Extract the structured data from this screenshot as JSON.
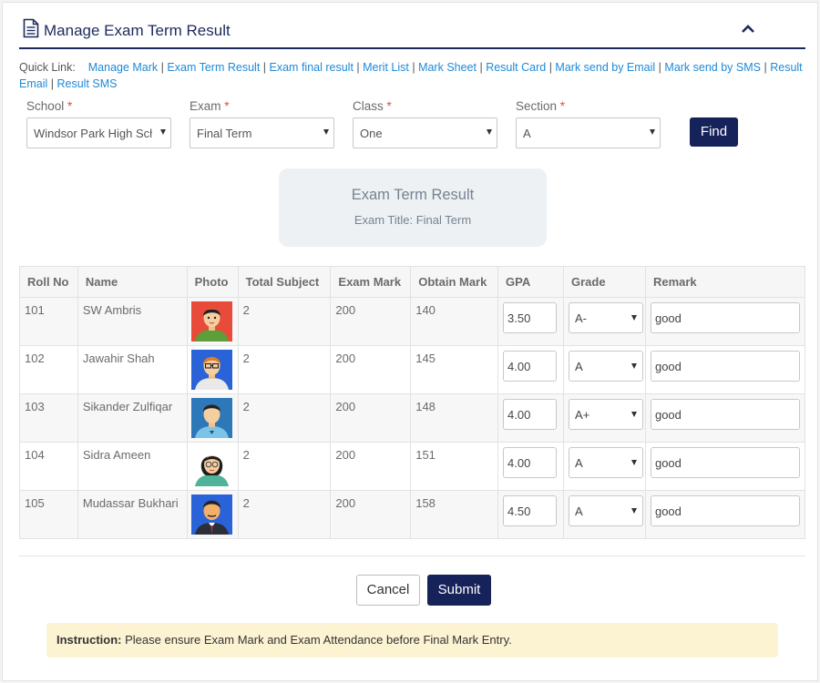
{
  "header": {
    "title": "Manage Exam Term Result"
  },
  "quick_links": {
    "label": "Quick Link:",
    "items": [
      "Manage Mark",
      "Exam Term Result",
      "Exam final result",
      "Merit List",
      "Mark Sheet",
      "Result Card",
      "Mark send by Email",
      "Mark send by SMS",
      "Result Email",
      "Result SMS"
    ]
  },
  "filters": {
    "school": {
      "label": "School",
      "value": "Windsor Park High School"
    },
    "exam": {
      "label": "Exam",
      "value": "Final Term"
    },
    "class": {
      "label": "Class",
      "value": "One"
    },
    "section": {
      "label": "Section",
      "value": "A"
    },
    "required_mark": "*",
    "find_label": "Find"
  },
  "result_box": {
    "title": "Exam Term Result",
    "subtitle": "Exam Title: Final Term"
  },
  "table": {
    "columns": [
      "Roll No",
      "Name",
      "Photo",
      "Total Subject",
      "Exam Mark",
      "Obtain Mark",
      "GPA",
      "Grade",
      "Remark"
    ],
    "rows": [
      {
        "roll": "101",
        "name": "SW Ambris",
        "photo": "avatar-boy-red",
        "total_subject": "2",
        "exam_mark": "200",
        "obtain_mark": "140",
        "gpa": "3.50",
        "grade": "A-",
        "remark": "good"
      },
      {
        "roll": "102",
        "name": "Jawahir Shah",
        "photo": "avatar-boy-glasses",
        "total_subject": "2",
        "exam_mark": "200",
        "obtain_mark": "145",
        "gpa": "4.00",
        "grade": "A",
        "remark": "good"
      },
      {
        "roll": "103",
        "name": "Sikander Zulfiqar",
        "photo": "avatar-man-blue",
        "total_subject": "2",
        "exam_mark": "200",
        "obtain_mark": "148",
        "gpa": "4.00",
        "grade": "A+",
        "remark": "good"
      },
      {
        "roll": "104",
        "name": "Sidra Ameen",
        "photo": "avatar-girl-glasses",
        "total_subject": "2",
        "exam_mark": "200",
        "obtain_mark": "151",
        "gpa": "4.00",
        "grade": "A",
        "remark": "good"
      },
      {
        "roll": "105",
        "name": "Mudassar Bukhari",
        "photo": "avatar-man-suit",
        "total_subject": "2",
        "exam_mark": "200",
        "obtain_mark": "158",
        "gpa": "4.50",
        "grade": "A",
        "remark": "good"
      }
    ]
  },
  "actions": {
    "cancel_label": "Cancel",
    "submit_label": "Submit"
  },
  "instruction": {
    "label": "Instruction:",
    "text": "Please ensure Exam Mark and Exam Attendance before Final Mark Entry."
  },
  "colors": {
    "primary": "#16225a",
    "link": "#1e8ad6",
    "required": "#e74c3c",
    "instruction_bg": "#fcf3d2"
  }
}
